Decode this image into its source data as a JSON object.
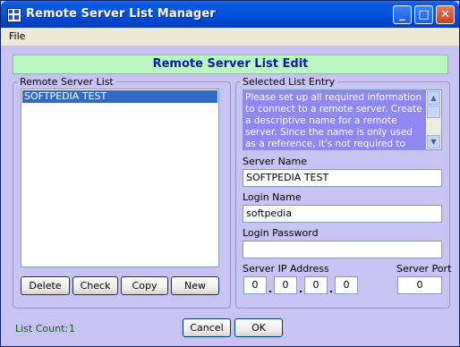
{
  "window": {
    "title": "Remote Server List Manager",
    "minimize": "_",
    "maximize": "□",
    "close": "✕"
  },
  "menu": {
    "file": "File"
  },
  "banner": "Remote Server List Edit",
  "server_list": {
    "legend": "Remote Server List",
    "items": [
      "SOFTPEDIA TEST"
    ],
    "buttons": {
      "delete": "Delete",
      "check": "Check",
      "copy": "Copy",
      "new": "New"
    }
  },
  "entry": {
    "legend": "Selected List Entry",
    "info_text": "Please set up all required information to connect to a remote server. Create a descriptive name for a remote server. Since the name is only used as a reference, it's not required to match with",
    "server_name_label": "Server Name",
    "server_name_value": "SOFTPEDIA TEST",
    "login_name_label": "Login Name",
    "login_name_value": "softpedia",
    "login_password_label": "Login Password",
    "login_password_value": "",
    "ip_label": "Server IP Address",
    "ip": [
      "0",
      "0",
      "0",
      "0"
    ],
    "port_label": "Server Port",
    "port_value": "0"
  },
  "footer": {
    "list_count_label": "List Count:",
    "list_count_value": "1",
    "cancel": "Cancel",
    "ok": "OK"
  },
  "colors": {
    "window_bg": "#c9c3f3",
    "banner_bg": "#baf8c2",
    "banner_text": "#0b1aa8",
    "selection": "#316ac5",
    "info_bg": "#8f87f2",
    "count_text": "#0b5a14"
  }
}
